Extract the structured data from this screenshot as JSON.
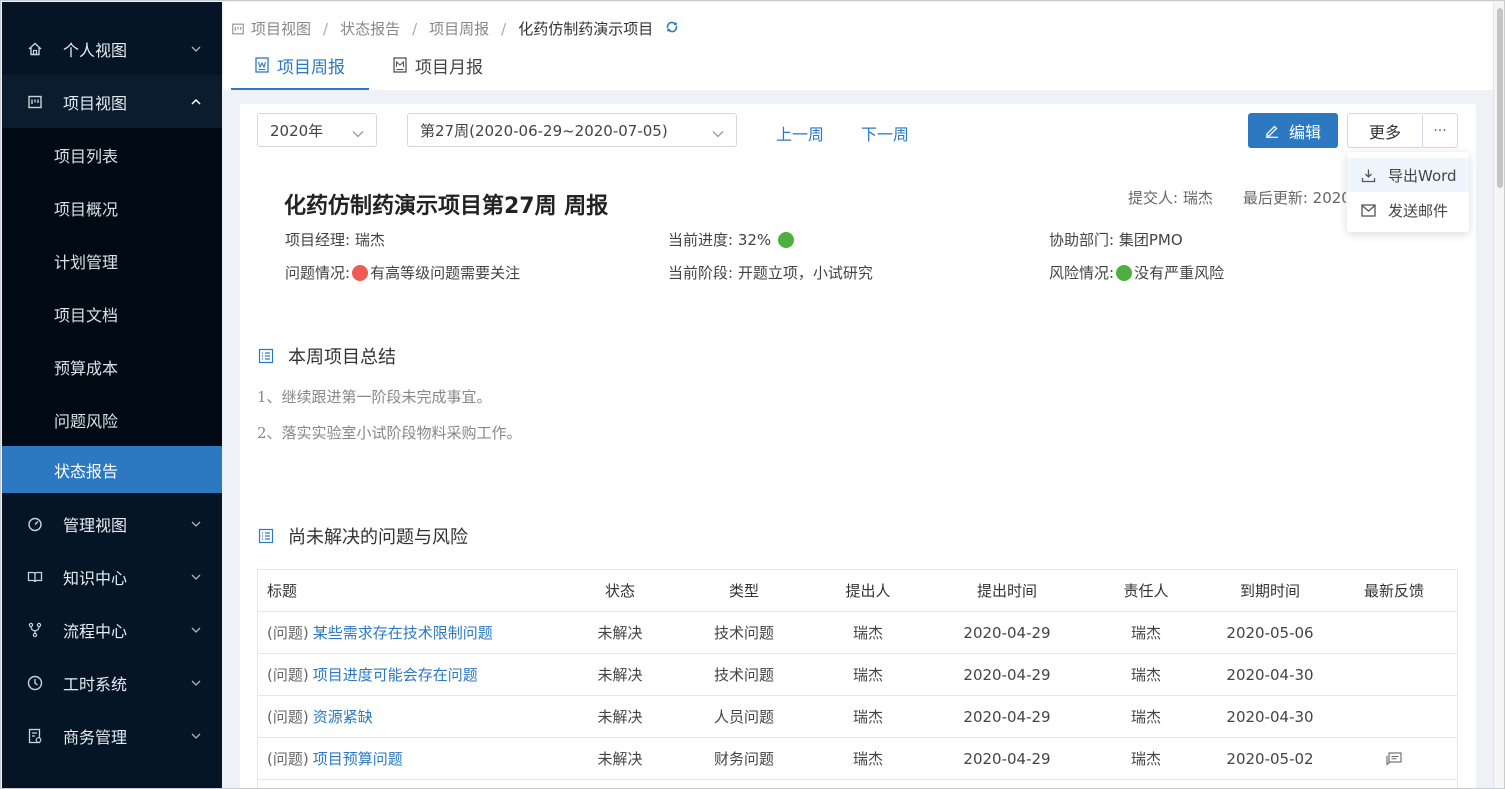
{
  "sidebar": {
    "items": [
      {
        "label": "个人视图",
        "icon": "home-icon"
      },
      {
        "label": "项目视图",
        "icon": "project-board-icon"
      },
      {
        "label": "管理视图",
        "icon": "dashboard-gauge-icon"
      },
      {
        "label": "知识中心",
        "icon": "book-icon"
      },
      {
        "label": "流程中心",
        "icon": "flow-branch-icon"
      },
      {
        "label": "工时系统",
        "icon": "clock-icon"
      },
      {
        "label": "商务管理",
        "icon": "business-doc-icon"
      }
    ],
    "sub_items": [
      "项目列表",
      "项目概况",
      "计划管理",
      "项目文档",
      "预算成本",
      "问题风险",
      "状态报告"
    ],
    "active_sub": "状态报告"
  },
  "breadcrumb": {
    "items": [
      "项目视图",
      "状态报告",
      "项目周报"
    ],
    "current": "化药仿制药演示项目",
    "separator": "/"
  },
  "tabs": [
    {
      "label": "项目周报",
      "active": true
    },
    {
      "label": "项目月报",
      "active": false
    }
  ],
  "toolbar": {
    "year_select": "2020年",
    "week_select": "第27周(2020-06-29~2020-07-05)",
    "prev_week": "上一周",
    "next_week": "下一周",
    "edit": "编辑",
    "more": "更多",
    "ellipsis": "···"
  },
  "dropdown": {
    "export_word": "导出Word",
    "send_email": "发送邮件"
  },
  "report": {
    "title": "化药仿制药演示项目第27周 周报",
    "submitter": "提交人: 瑞杰",
    "last_updated": "最后更新: 2020-",
    "manager_label": "项目经理:",
    "manager": "瑞杰",
    "progress_label": "当前进度:",
    "progress": "32%",
    "dept_label": "协助部门:",
    "dept": "集团PMO",
    "issue_label": "问题情况:",
    "issue": "有高等级问题需要关注",
    "stage_label": "当前阶段:",
    "stage": "开题立项，小试研究",
    "risk_label": "风险情况:",
    "risk": "没有严重风险"
  },
  "summary": {
    "title": "本周项目总结",
    "lines": [
      "1、继续跟进第一阶段未完成事宜。",
      "2、落实实验室小试阶段物料采购工作。"
    ]
  },
  "issues": {
    "title": "尚未解决的问题与风险",
    "columns": [
      "标题",
      "状态",
      "类型",
      "提出人",
      "提出时间",
      "责任人",
      "到期时间",
      "最新反馈"
    ],
    "rows": [
      {
        "prefix": "(问题)",
        "title": "某些需求存在技术限制问题",
        "status": "未解决",
        "type": "技术问题",
        "proposer": "瑞杰",
        "date": "2020-04-29",
        "owner": "瑞杰",
        "due": "2020-05-06",
        "feedback": false
      },
      {
        "prefix": "(问题)",
        "title": "项目进度可能会存在问题",
        "status": "未解决",
        "type": "技术问题",
        "proposer": "瑞杰",
        "date": "2020-04-29",
        "owner": "瑞杰",
        "due": "2020-04-30",
        "feedback": false
      },
      {
        "prefix": "(问题)",
        "title": "资源紧缺",
        "status": "未解决",
        "type": "人员问题",
        "proposer": "瑞杰",
        "date": "2020-04-29",
        "owner": "瑞杰",
        "due": "2020-04-30",
        "feedback": false
      },
      {
        "prefix": "(问题)",
        "title": "项目预算问题",
        "status": "未解决",
        "type": "财务问题",
        "proposer": "瑞杰",
        "date": "2020-04-29",
        "owner": "瑞杰",
        "due": "2020-05-02",
        "feedback": true
      }
    ]
  },
  "colors": {
    "accent": "#2c79c2",
    "sidebar_bg": "#061526",
    "status_green": "#4caf3f",
    "status_red": "#ee5b55"
  }
}
